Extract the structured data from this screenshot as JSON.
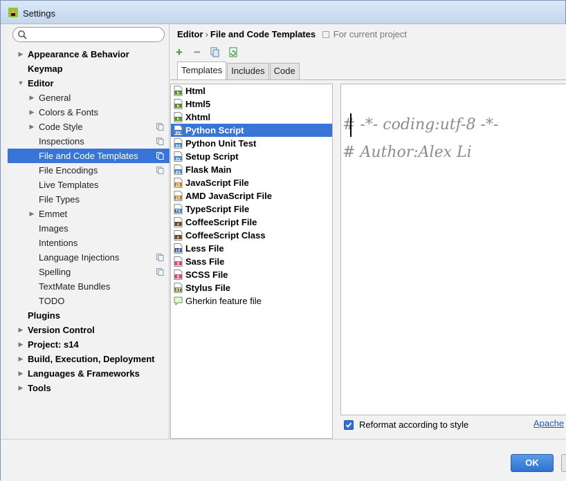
{
  "window": {
    "title": "Settings"
  },
  "search": {
    "placeholder": ""
  },
  "sidebar": {
    "items": [
      {
        "label": "Appearance & Behavior",
        "indent": 0,
        "arrow": "right",
        "bold": true
      },
      {
        "label": "Keymap",
        "indent": 0,
        "arrow": "",
        "bold": true
      },
      {
        "label": "Editor",
        "indent": 0,
        "arrow": "down",
        "bold": true
      },
      {
        "label": "General",
        "indent": 1,
        "arrow": "right"
      },
      {
        "label": "Colors & Fonts",
        "indent": 1,
        "arrow": "right"
      },
      {
        "label": "Code Style",
        "indent": 1,
        "arrow": "right",
        "badge": true
      },
      {
        "label": "Inspections",
        "indent": 1,
        "arrow": "",
        "badge": true
      },
      {
        "label": "File and Code Templates",
        "indent": 1,
        "arrow": "",
        "badge": true,
        "selected": true
      },
      {
        "label": "File Encodings",
        "indent": 1,
        "arrow": "",
        "badge": true
      },
      {
        "label": "Live Templates",
        "indent": 1,
        "arrow": ""
      },
      {
        "label": "File Types",
        "indent": 1,
        "arrow": ""
      },
      {
        "label": "Emmet",
        "indent": 1,
        "arrow": "right"
      },
      {
        "label": "Images",
        "indent": 1,
        "arrow": ""
      },
      {
        "label": "Intentions",
        "indent": 1,
        "arrow": ""
      },
      {
        "label": "Language Injections",
        "indent": 1,
        "arrow": "",
        "badge": true
      },
      {
        "label": "Spelling",
        "indent": 1,
        "arrow": "",
        "badge": true
      },
      {
        "label": "TextMate Bundles",
        "indent": 1,
        "arrow": ""
      },
      {
        "label": "TODO",
        "indent": 1,
        "arrow": ""
      },
      {
        "label": "Plugins",
        "indent": 0,
        "arrow": "",
        "bold": true
      },
      {
        "label": "Version Control",
        "indent": 0,
        "arrow": "right",
        "bold": true
      },
      {
        "label": "Project: s14",
        "indent": 0,
        "arrow": "right",
        "bold": true
      },
      {
        "label": "Build, Execution, Deployment",
        "indent": 0,
        "arrow": "right",
        "bold": true
      },
      {
        "label": "Languages & Frameworks",
        "indent": 0,
        "arrow": "right",
        "bold": true
      },
      {
        "label": "Tools",
        "indent": 0,
        "arrow": "right",
        "bold": true
      }
    ]
  },
  "breadcrumb": {
    "part1": "Editor",
    "separator": "›",
    "part2": "File and Code Templates",
    "scope": "For current project"
  },
  "toolbar": {
    "add": "+",
    "remove": "−",
    "icons": [
      "plus-icon",
      "minus-icon",
      "copy-icon",
      "reset-icon"
    ]
  },
  "tabs": [
    {
      "label": "Templates",
      "active": true
    },
    {
      "label": "Includes"
    },
    {
      "label": "Code"
    }
  ],
  "templates": [
    {
      "label": "Html",
      "icon": "html-file-icon",
      "iconText": "h",
      "color": "#5a8a2a"
    },
    {
      "label": "Html5",
      "icon": "html-file-icon",
      "iconText": "h",
      "color": "#5a8a2a"
    },
    {
      "label": "Xhtml",
      "icon": "html-file-icon",
      "iconText": "h",
      "color": "#5a8a2a"
    },
    {
      "label": "Python Script",
      "icon": "python-file-icon",
      "iconText": "py",
      "color": "#3b7bbf",
      "selected": true
    },
    {
      "label": "Python Unit Test",
      "icon": "python-file-icon",
      "iconText": "py",
      "color": "#3b7bbf"
    },
    {
      "label": "Setup Script",
      "icon": "python-file-icon",
      "iconText": "py",
      "color": "#3b7bbf"
    },
    {
      "label": "Flask Main",
      "icon": "python-file-icon",
      "iconText": "py",
      "color": "#3b7bbf"
    },
    {
      "label": "JavaScript File",
      "icon": "javascript-file-icon",
      "iconText": "JS",
      "color": "#c8802a"
    },
    {
      "label": "AMD JavaScript File",
      "icon": "javascript-file-icon",
      "iconText": "JS",
      "color": "#c8802a"
    },
    {
      "label": "TypeScript File",
      "icon": "typescript-file-icon",
      "iconText": "TS",
      "color": "#2f6fb8"
    },
    {
      "label": "CoffeeScript File",
      "icon": "coffeescript-file-icon",
      "iconText": "c",
      "color": "#6a4a2a"
    },
    {
      "label": "CoffeeScript Class",
      "icon": "coffeescript-file-icon",
      "iconText": "c",
      "color": "#6a4a2a"
    },
    {
      "label": "Less File",
      "icon": "less-file-icon",
      "iconText": "LE",
      "color": "#2a4f8a"
    },
    {
      "label": "Sass File",
      "icon": "sass-file-icon",
      "iconText": "S",
      "color": "#c84a7a"
    },
    {
      "label": "SCSS File",
      "icon": "sass-file-icon",
      "iconText": "S",
      "color": "#c84a7a"
    },
    {
      "label": "Stylus File",
      "icon": "stylus-file-icon",
      "iconText": "ST",
      "color": "#6a7a2a"
    },
    {
      "label": "Gherkin feature file",
      "icon": "gherkin-file-icon",
      "iconText": "",
      "color": "#5aa03a",
      "normal": true
    }
  ],
  "editor": {
    "lines": [
      "# -*- coding:utf-8 -*-",
      "# Author:Alex Li"
    ]
  },
  "reformat": {
    "label": "Reformat according to style",
    "checked": true
  },
  "apache": {
    "label": "Apache"
  },
  "buttons": {
    "ok": "OK"
  },
  "colors": {
    "selection": "#3875d7",
    "accent": "#2f6fd6"
  }
}
